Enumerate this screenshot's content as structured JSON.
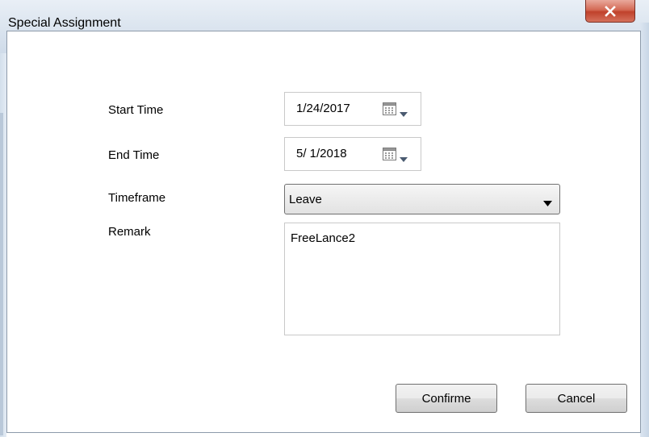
{
  "window": {
    "title": "Special Assignment",
    "close_icon": "close-x-icon"
  },
  "form": {
    "start_time": {
      "label": "Start Time",
      "value": "1/24/2017",
      "icon": "calendar-icon"
    },
    "end_time": {
      "label": "End Time",
      "value": "5/ 1/2018",
      "icon": "calendar-icon"
    },
    "timeframe": {
      "label": "Timeframe",
      "selected": "Leave",
      "icon": "chevron-down-icon"
    },
    "remark": {
      "label": "Remark",
      "value": "FreeLance2"
    }
  },
  "buttons": {
    "confirm": "Confirme",
    "cancel": "Cancel"
  },
  "colors": {
    "titlebar": "#dde6f0",
    "close_button": "#c7503b",
    "border": "#c9c9c9"
  }
}
